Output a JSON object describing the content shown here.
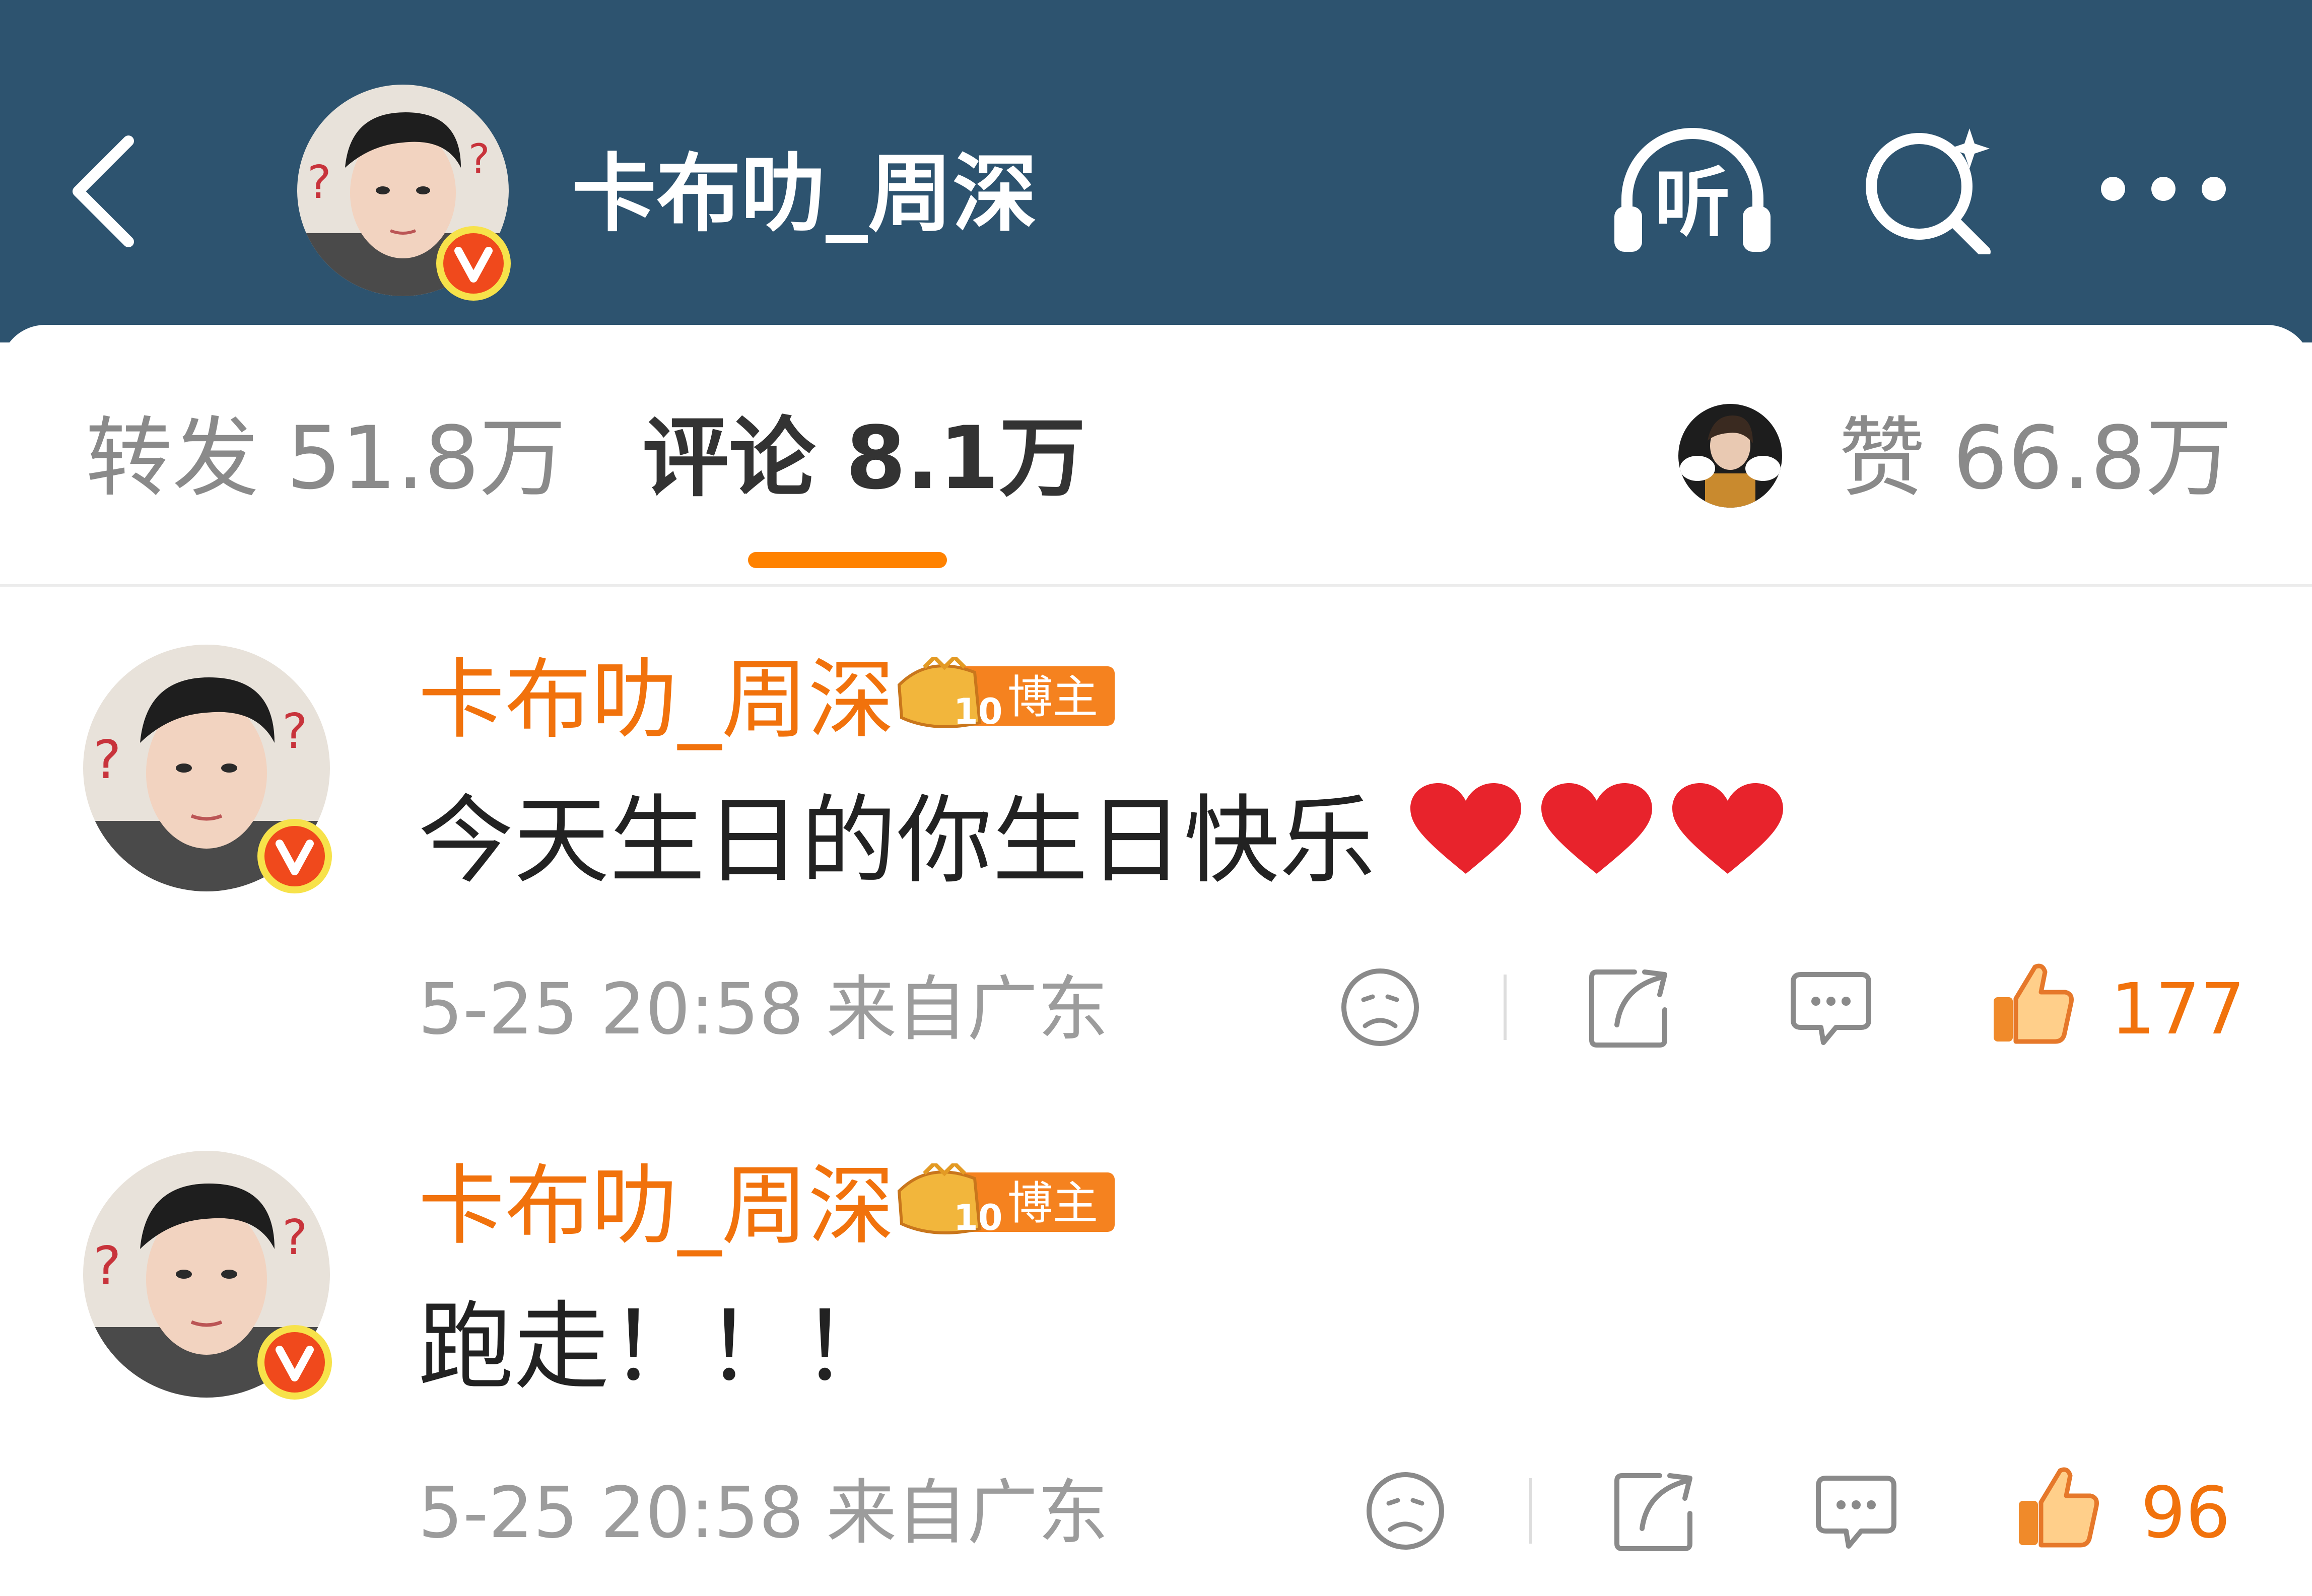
{
  "header": {
    "title": "卡布叻_周深",
    "back_icon": "chevron-left-icon",
    "listen_label": "听",
    "colors": {
      "bar": "#2d536f",
      "accent": "#ff8200",
      "verified": "#f0491c"
    }
  },
  "tabs": {
    "repost": {
      "label": "转发",
      "count": "51.8万"
    },
    "comment": {
      "label": "评论",
      "count": "8.1万"
    },
    "like": {
      "label": "赞",
      "count": "66.8万"
    }
  },
  "comments": [
    {
      "author": "卡布叻_周深",
      "badge_level": "10",
      "badge_text": "博主",
      "text": "今天生日的你生日快乐",
      "emoji": "❤️❤️❤️",
      "time": "5-25 20:58",
      "location": "来自广东",
      "likes": "177"
    },
    {
      "author": "卡布叻_周深",
      "badge_level": "10",
      "badge_text": "博主",
      "text": "跑走！！！",
      "emoji": "",
      "time": "5-25 20:58",
      "location": "来自广东",
      "likes": "96"
    }
  ]
}
